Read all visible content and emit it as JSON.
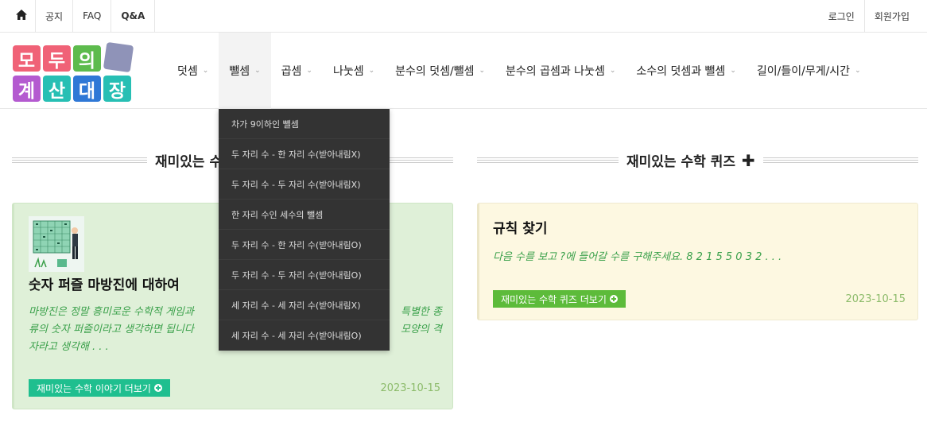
{
  "topbar": {
    "left": [
      {
        "icon": "home-icon"
      },
      {
        "label": "공지"
      },
      {
        "label": "FAQ"
      },
      {
        "label": "Q&A"
      }
    ],
    "right": [
      {
        "label": "로그인"
      },
      {
        "label": "회원가입"
      }
    ]
  },
  "logo": {
    "chars": [
      "모",
      "두",
      "의",
      "계",
      "산",
      "대",
      "장"
    ],
    "colors": {
      "red": "#f06277",
      "green": "#5dbb4d",
      "purple": "#b45ad0",
      "teal": "#27bfb4",
      "blue": "#2f78d6",
      "gray": "#8f93b8"
    }
  },
  "nav": {
    "items": [
      "덧셈",
      "뺄셈",
      "곱셈",
      "나눗셈",
      "분수의 덧셈/뺄셈",
      "분수의 곱셈과 나눗셈",
      "소수의 덧셈과 뺄셈",
      "길이/들이/무게/시간"
    ],
    "active_index": 1
  },
  "dropdown": {
    "items": [
      "차가 9이하인 뺄셈",
      "두 자리 수 - 한 자리 수(받아내림X)",
      "두 자리 수 - 두 자리 수(받아내림X)",
      "한 자리 수인 세수의 뺄셈",
      "두 자리 수 - 한 자리 수(받아내림O)",
      "두 자리 수 - 두 자리 수(받아내림O)",
      "세 자리 수 - 세 자리 수(받아내림X)",
      "세 자리 수 - 세 자리 수(받아내림O)"
    ]
  },
  "sections": {
    "left_title": "재미있는 수",
    "right_title": "재미있는 수학 퀴즈"
  },
  "story_card": {
    "title": "숫자 퍼즐 마방진에 대하여",
    "text_line1": "마방진은 정말 흥미로운 수학적 게임과",
    "text_line1_end": "특별한 종",
    "text_line2": "류의 숫자 퍼즐이라고 생각하면 됩니다",
    "text_line2_end": "모양의 격",
    "text_line3": "자라고 생각해 . . .",
    "button": "재미있는 수학 이야기 더보기",
    "date": "2023-10-15",
    "button_color": "#1fbf8f"
  },
  "quiz_card": {
    "title": "규칙 찾기",
    "text": "다음 수를 보고 ?에 들어갈 수를 구해주세요. 8 2 1 5 5 0 3 2 . . .",
    "button": "재미있는 수학 퀴즈 더보기",
    "date": "2023-10-15",
    "button_color": "#5dbb3a"
  }
}
